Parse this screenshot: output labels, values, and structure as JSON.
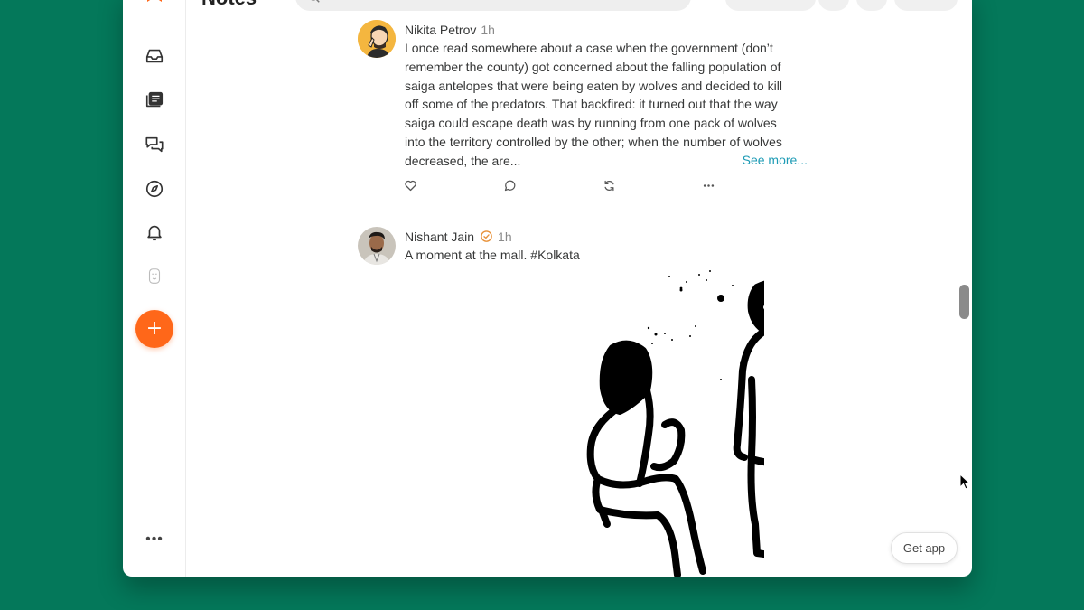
{
  "header": {
    "title": "Notes"
  },
  "sidebar": {
    "items": [
      {
        "label": "Inbox",
        "icon": "inbox-icon"
      },
      {
        "label": "Reader",
        "icon": "reader-icon"
      },
      {
        "label": "Chat",
        "icon": "chat-icon"
      },
      {
        "label": "Explore",
        "icon": "compass-icon"
      },
      {
        "label": "Activity",
        "icon": "bell-icon"
      },
      {
        "label": "Profile",
        "icon": "profile-avatar-icon"
      }
    ],
    "create_icon": "plus-icon",
    "more_label": "•••"
  },
  "feed": {
    "notes": [
      {
        "author": "Nikita Petrov",
        "time": "1h",
        "lines": [
          "I once read somewhere about a case when the government (don’t",
          "remember the county) got concerned about the falling population of",
          "saiga antelopes that were being eaten by wolves and decided to kill",
          "off some of the predators. That backfired: it turned out that the way",
          "saiga could escape death was by running from one pack of wolves",
          "into the territory controlled by the other; when the number of wolves",
          "decreased, the are..."
        ],
        "see_more": "See more...",
        "actions": [
          "heart-icon",
          "comment-icon",
          "restack-icon",
          "more-icon"
        ]
      },
      {
        "author": "Nishant Jain",
        "verified": true,
        "time": "1h",
        "text": "A moment at the mall. #Kolkata",
        "image": "hand-drawn-sketch"
      }
    ]
  },
  "get_app_label": "Get app",
  "colors": {
    "background": "#04785a",
    "accent": "#ff6719",
    "link": "#1d9bb5",
    "verified": "#e8923a"
  }
}
